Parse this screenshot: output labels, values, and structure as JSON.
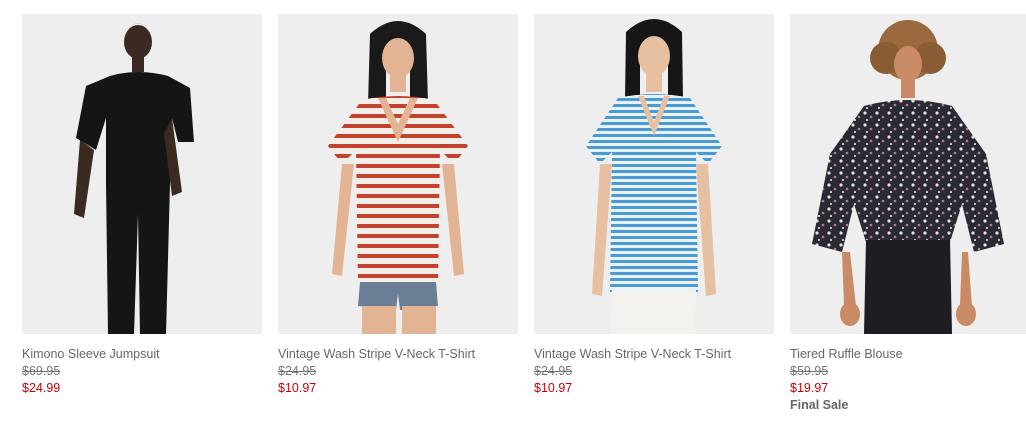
{
  "products": [
    {
      "name": "Kimono Sleeve Jumpsuit",
      "original_price": "$69.95",
      "sale_price": "$24.99",
      "badge": ""
    },
    {
      "name": "Vintage Wash Stripe V-Neck T-Shirt",
      "original_price": "$24.95",
      "sale_price": "$10.97",
      "badge": ""
    },
    {
      "name": "Vintage Wash Stripe V-Neck T-Shirt",
      "original_price": "$24.95",
      "sale_price": "$10.97",
      "badge": ""
    },
    {
      "name": "Tiered Ruffle Blouse",
      "original_price": "$59.95",
      "sale_price": "$19.97",
      "badge": "Final Sale"
    }
  ],
  "colors": {
    "photo_background": "#eeeeee",
    "product_name": "#666666",
    "original_price": "#757575",
    "sale_price": "#d00000"
  }
}
